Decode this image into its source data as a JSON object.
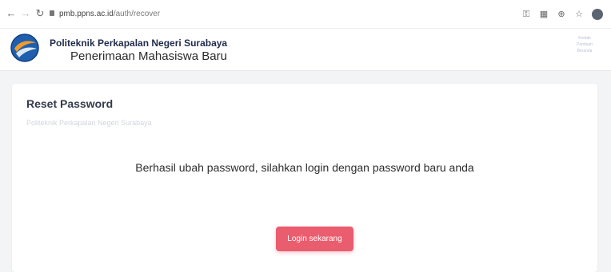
{
  "browser": {
    "url_host": "pmb.ppns.ac.id",
    "url_path": "/auth/recover"
  },
  "header": {
    "institution": "Politeknik Perkapalan Negeri Surabaya",
    "subtitle": "Penerimaan Mahasiswa Baru",
    "menu_lines": [
      "Kontak",
      "Panduan",
      "Beranda"
    ]
  },
  "card": {
    "title": "Reset Password",
    "subtitle": "Politeknik Perkapalan Negeri Surabaya",
    "message": "Berhasil ubah password, silahkan login dengan password baru anda",
    "button_label": "Login sekarang"
  },
  "colors": {
    "accent_button": "#ea5d6e",
    "page_background": "#f3f4f6",
    "header_title": "#1e2b4a"
  }
}
